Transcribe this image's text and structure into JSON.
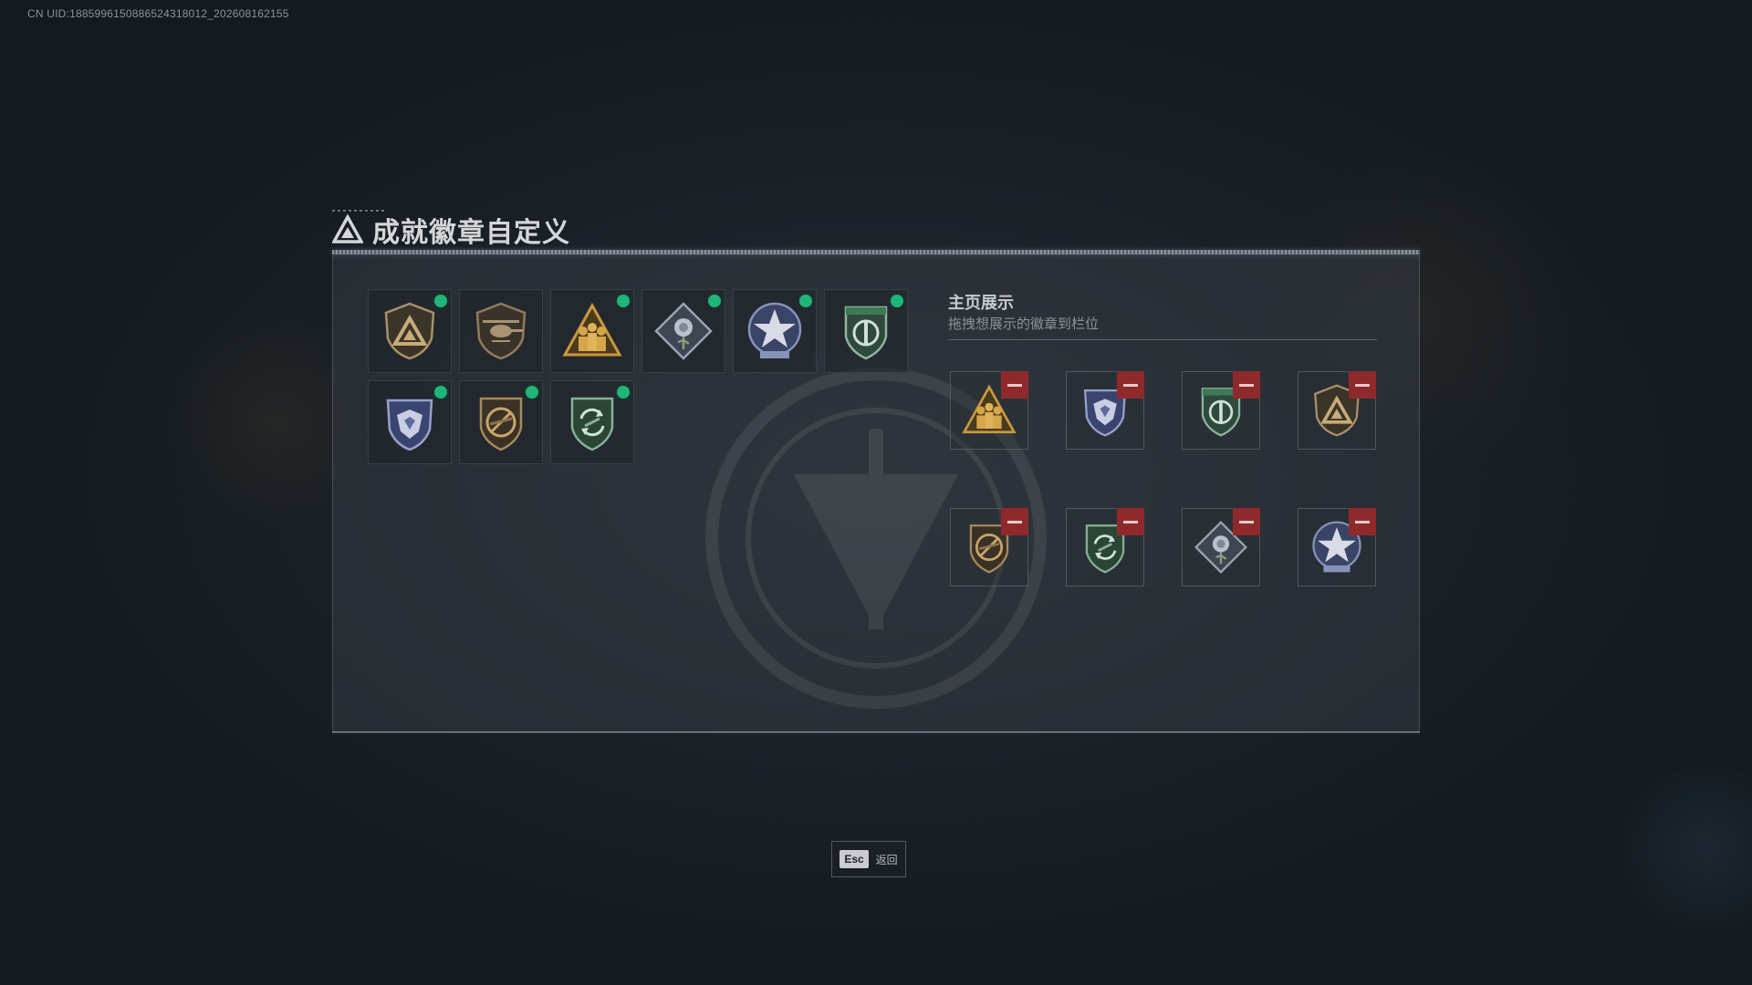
{
  "uid_text": "CN UID:1885996150886524318012_202608162155",
  "title": "成就徽章自定义",
  "collection": {
    "badges": [
      {
        "icon": "triangle-shield-badge-icon",
        "equipped": true
      },
      {
        "icon": "helicopter-shield-badge-icon",
        "equipped": false
      },
      {
        "icon": "soldiers-triangle-badge-icon",
        "equipped": true
      },
      {
        "icon": "rose-diamond-badge-icon",
        "equipped": true
      },
      {
        "icon": "star-circle-badge-icon",
        "equipped": true
      },
      {
        "icon": "green-shield-badge-icon",
        "equipped": true
      },
      {
        "icon": "eagle-blue-shield-badge-icon",
        "equipped": true
      },
      {
        "icon": "no-rifle-shield-badge-icon",
        "equipped": true
      },
      {
        "icon": "recycle-green-shield-badge-icon",
        "equipped": true
      }
    ]
  },
  "display": {
    "title": "主页展示",
    "subtitle": "拖拽想展示的徽章到栏位",
    "slots": [
      {
        "icon": "soldiers-triangle-badge-icon"
      },
      {
        "icon": "eagle-blue-shield-badge-icon"
      },
      {
        "icon": "green-shield-badge-icon"
      },
      {
        "icon": "triangle-shield-badge-icon"
      },
      {
        "icon": "no-rifle-shield-badge-icon"
      },
      {
        "icon": "recycle-green-shield-badge-icon"
      },
      {
        "icon": "rose-diamond-badge-icon"
      },
      {
        "icon": "star-circle-badge-icon"
      }
    ]
  },
  "footer": {
    "key": "Esc",
    "label": "返回"
  },
  "colors": {
    "equipped_dot": "#21b57a",
    "remove_button": "#8e2a2c"
  }
}
